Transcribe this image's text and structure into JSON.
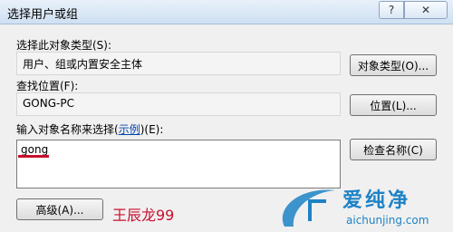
{
  "window": {
    "title": "选择用户或组",
    "help_label": "?",
    "close_label": "✕"
  },
  "object_type": {
    "label": "选择此对象类型(S):",
    "value": "用户、组或内置安全主体",
    "button": "对象类型(O)..."
  },
  "location": {
    "label": "查找位置(F):",
    "value": "GONG-PC",
    "button": "位置(L)..."
  },
  "input_section": {
    "label_prefix": "输入对象名称来选择(",
    "label_link": "示例",
    "label_suffix": ")(E):",
    "value": "gong",
    "check_button": "检查名称(C)"
  },
  "advanced_button": "高级(A)...",
  "annotation": "王辰龙99",
  "watermark": {
    "brand_cn": "爱纯净",
    "url": "aichunjing.com"
  }
}
